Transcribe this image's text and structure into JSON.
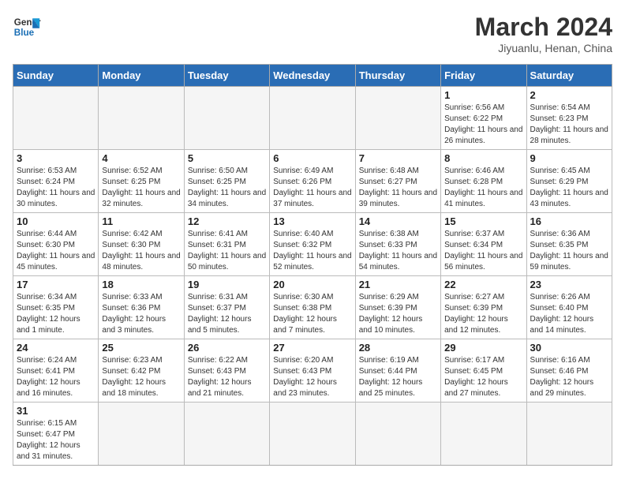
{
  "header": {
    "logo_text_general": "General",
    "logo_text_blue": "Blue",
    "month_title": "March 2024",
    "subtitle": "Jiyuanlu, Henan, China"
  },
  "weekdays": [
    "Sunday",
    "Monday",
    "Tuesday",
    "Wednesday",
    "Thursday",
    "Friday",
    "Saturday"
  ],
  "weeks": [
    [
      {
        "day": "",
        "info": ""
      },
      {
        "day": "",
        "info": ""
      },
      {
        "day": "",
        "info": ""
      },
      {
        "day": "",
        "info": ""
      },
      {
        "day": "",
        "info": ""
      },
      {
        "day": "1",
        "info": "Sunrise: 6:56 AM\nSunset: 6:22 PM\nDaylight: 11 hours and 26 minutes."
      },
      {
        "day": "2",
        "info": "Sunrise: 6:54 AM\nSunset: 6:23 PM\nDaylight: 11 hours and 28 minutes."
      }
    ],
    [
      {
        "day": "3",
        "info": "Sunrise: 6:53 AM\nSunset: 6:24 PM\nDaylight: 11 hours and 30 minutes."
      },
      {
        "day": "4",
        "info": "Sunrise: 6:52 AM\nSunset: 6:25 PM\nDaylight: 11 hours and 32 minutes."
      },
      {
        "day": "5",
        "info": "Sunrise: 6:50 AM\nSunset: 6:25 PM\nDaylight: 11 hours and 34 minutes."
      },
      {
        "day": "6",
        "info": "Sunrise: 6:49 AM\nSunset: 6:26 PM\nDaylight: 11 hours and 37 minutes."
      },
      {
        "day": "7",
        "info": "Sunrise: 6:48 AM\nSunset: 6:27 PM\nDaylight: 11 hours and 39 minutes."
      },
      {
        "day": "8",
        "info": "Sunrise: 6:46 AM\nSunset: 6:28 PM\nDaylight: 11 hours and 41 minutes."
      },
      {
        "day": "9",
        "info": "Sunrise: 6:45 AM\nSunset: 6:29 PM\nDaylight: 11 hours and 43 minutes."
      }
    ],
    [
      {
        "day": "10",
        "info": "Sunrise: 6:44 AM\nSunset: 6:30 PM\nDaylight: 11 hours and 45 minutes."
      },
      {
        "day": "11",
        "info": "Sunrise: 6:42 AM\nSunset: 6:30 PM\nDaylight: 11 hours and 48 minutes."
      },
      {
        "day": "12",
        "info": "Sunrise: 6:41 AM\nSunset: 6:31 PM\nDaylight: 11 hours and 50 minutes."
      },
      {
        "day": "13",
        "info": "Sunrise: 6:40 AM\nSunset: 6:32 PM\nDaylight: 11 hours and 52 minutes."
      },
      {
        "day": "14",
        "info": "Sunrise: 6:38 AM\nSunset: 6:33 PM\nDaylight: 11 hours and 54 minutes."
      },
      {
        "day": "15",
        "info": "Sunrise: 6:37 AM\nSunset: 6:34 PM\nDaylight: 11 hours and 56 minutes."
      },
      {
        "day": "16",
        "info": "Sunrise: 6:36 AM\nSunset: 6:35 PM\nDaylight: 11 hours and 59 minutes."
      }
    ],
    [
      {
        "day": "17",
        "info": "Sunrise: 6:34 AM\nSunset: 6:35 PM\nDaylight: 12 hours and 1 minute."
      },
      {
        "day": "18",
        "info": "Sunrise: 6:33 AM\nSunset: 6:36 PM\nDaylight: 12 hours and 3 minutes."
      },
      {
        "day": "19",
        "info": "Sunrise: 6:31 AM\nSunset: 6:37 PM\nDaylight: 12 hours and 5 minutes."
      },
      {
        "day": "20",
        "info": "Sunrise: 6:30 AM\nSunset: 6:38 PM\nDaylight: 12 hours and 7 minutes."
      },
      {
        "day": "21",
        "info": "Sunrise: 6:29 AM\nSunset: 6:39 PM\nDaylight: 12 hours and 10 minutes."
      },
      {
        "day": "22",
        "info": "Sunrise: 6:27 AM\nSunset: 6:39 PM\nDaylight: 12 hours and 12 minutes."
      },
      {
        "day": "23",
        "info": "Sunrise: 6:26 AM\nSunset: 6:40 PM\nDaylight: 12 hours and 14 minutes."
      }
    ],
    [
      {
        "day": "24",
        "info": "Sunrise: 6:24 AM\nSunset: 6:41 PM\nDaylight: 12 hours and 16 minutes."
      },
      {
        "day": "25",
        "info": "Sunrise: 6:23 AM\nSunset: 6:42 PM\nDaylight: 12 hours and 18 minutes."
      },
      {
        "day": "26",
        "info": "Sunrise: 6:22 AM\nSunset: 6:43 PM\nDaylight: 12 hours and 21 minutes."
      },
      {
        "day": "27",
        "info": "Sunrise: 6:20 AM\nSunset: 6:43 PM\nDaylight: 12 hours and 23 minutes."
      },
      {
        "day": "28",
        "info": "Sunrise: 6:19 AM\nSunset: 6:44 PM\nDaylight: 12 hours and 25 minutes."
      },
      {
        "day": "29",
        "info": "Sunrise: 6:17 AM\nSunset: 6:45 PM\nDaylight: 12 hours and 27 minutes."
      },
      {
        "day": "30",
        "info": "Sunrise: 6:16 AM\nSunset: 6:46 PM\nDaylight: 12 hours and 29 minutes."
      }
    ],
    [
      {
        "day": "31",
        "info": "Sunrise: 6:15 AM\nSunset: 6:47 PM\nDaylight: 12 hours and 31 minutes."
      },
      {
        "day": "",
        "info": ""
      },
      {
        "day": "",
        "info": ""
      },
      {
        "day": "",
        "info": ""
      },
      {
        "day": "",
        "info": ""
      },
      {
        "day": "",
        "info": ""
      },
      {
        "day": "",
        "info": ""
      }
    ]
  ]
}
